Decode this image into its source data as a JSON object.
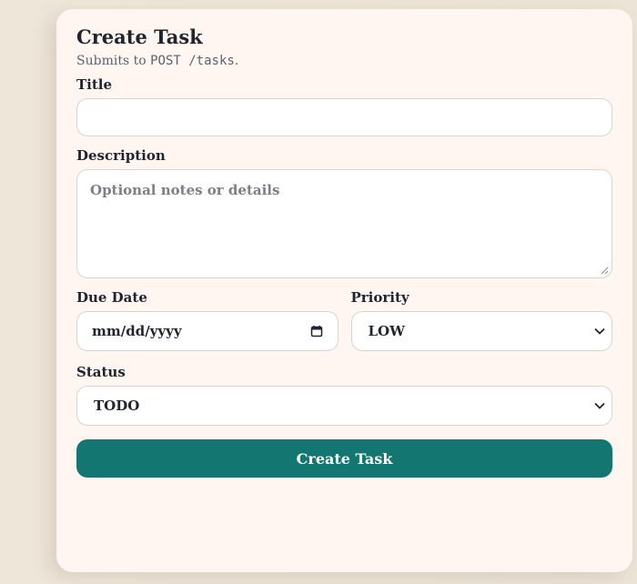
{
  "form": {
    "title": "Create Task",
    "subtitle_prefix": "Submits to ",
    "subtitle_code": "POST /tasks",
    "subtitle_suffix": ".",
    "fields": {
      "title": {
        "label": "Title",
        "value": ""
      },
      "description": {
        "label": "Description",
        "placeholder": "Optional notes or details",
        "value": ""
      },
      "due_date": {
        "label": "Due Date",
        "placeholder": "mm/dd/yyyy",
        "icon": "calendar-icon"
      },
      "priority": {
        "label": "Priority",
        "selected": "LOW",
        "icon": "chevron-down-icon"
      },
      "status": {
        "label": "Status",
        "selected": "TODO",
        "icon": "chevron-down-icon"
      }
    },
    "submit_label": "Create Task"
  },
  "colors": {
    "accent": "#137670",
    "card_bg": "#fff6f1",
    "page_bg": "#efe7dc",
    "text": "#1f2530",
    "muted": "#5b6270",
    "border": "#d9d4cf"
  }
}
